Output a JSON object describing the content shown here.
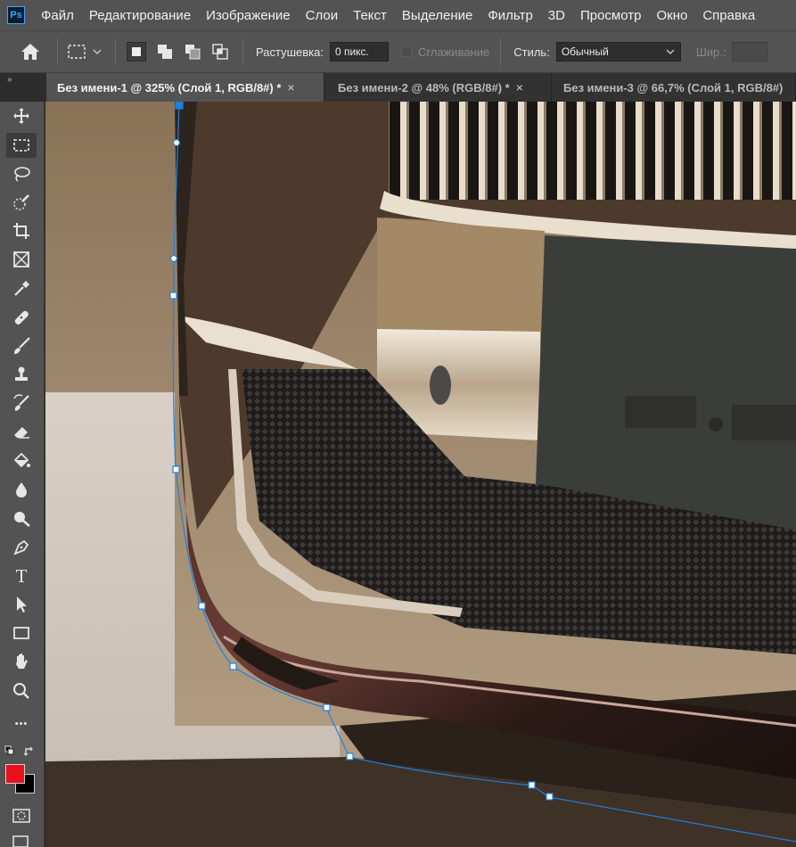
{
  "menubar": {
    "logo": "Ps",
    "items": [
      "Файл",
      "Редактирование",
      "Изображение",
      "Слои",
      "Текст",
      "Выделение",
      "Фильтр",
      "3D",
      "Просмотр",
      "Окно",
      "Справка"
    ]
  },
  "options": {
    "feather_label": "Растушевка:",
    "feather_value": "0 пикс.",
    "antialias_label": "Сглаживание",
    "style_label": "Стиль:",
    "style_value": "Обычный",
    "width_label": "Шир.:"
  },
  "tabs": [
    {
      "label": "Без имени-1 @ 325% (Слой 1, RGB/8#) *",
      "close": "×",
      "active": true
    },
    {
      "label": "Без имени-2 @ 48% (RGB/8#) *",
      "close": "×",
      "active": false
    },
    {
      "label": "Без имени-3 @ 66,7% (Слой 1, RGB/8#)",
      "close": "",
      "active": false
    }
  ],
  "tabs_gutter": "»",
  "tools": [
    {
      "icon": "move-icon"
    },
    {
      "icon": "rectangular-marquee-icon",
      "active": true
    },
    {
      "icon": "lasso-icon"
    },
    {
      "icon": "quick-selection-icon"
    },
    {
      "icon": "crop-icon"
    },
    {
      "icon": "frame-icon"
    },
    {
      "icon": "eyedropper-icon"
    },
    {
      "icon": "healing-brush-icon"
    },
    {
      "icon": "brush-icon"
    },
    {
      "icon": "clone-stamp-icon"
    },
    {
      "icon": "history-brush-icon"
    },
    {
      "icon": "eraser-icon"
    },
    {
      "icon": "paint-bucket-icon"
    },
    {
      "icon": "blur-icon"
    },
    {
      "icon": "dodge-icon"
    },
    {
      "icon": "pen-icon"
    },
    {
      "icon": "type-icon",
      "glyph": "T"
    },
    {
      "icon": "path-selection-icon"
    },
    {
      "icon": "rectangle-shape-icon"
    },
    {
      "icon": "hand-icon"
    },
    {
      "icon": "zoom-icon"
    },
    {
      "icon": "more-tools-icon",
      "glyph": "•••"
    }
  ],
  "colors": {
    "foreground": "#e8101a",
    "background": "#000000",
    "path": "#1f7fe0",
    "ui_bg": "#535353",
    "panel_dark": "#323232"
  }
}
